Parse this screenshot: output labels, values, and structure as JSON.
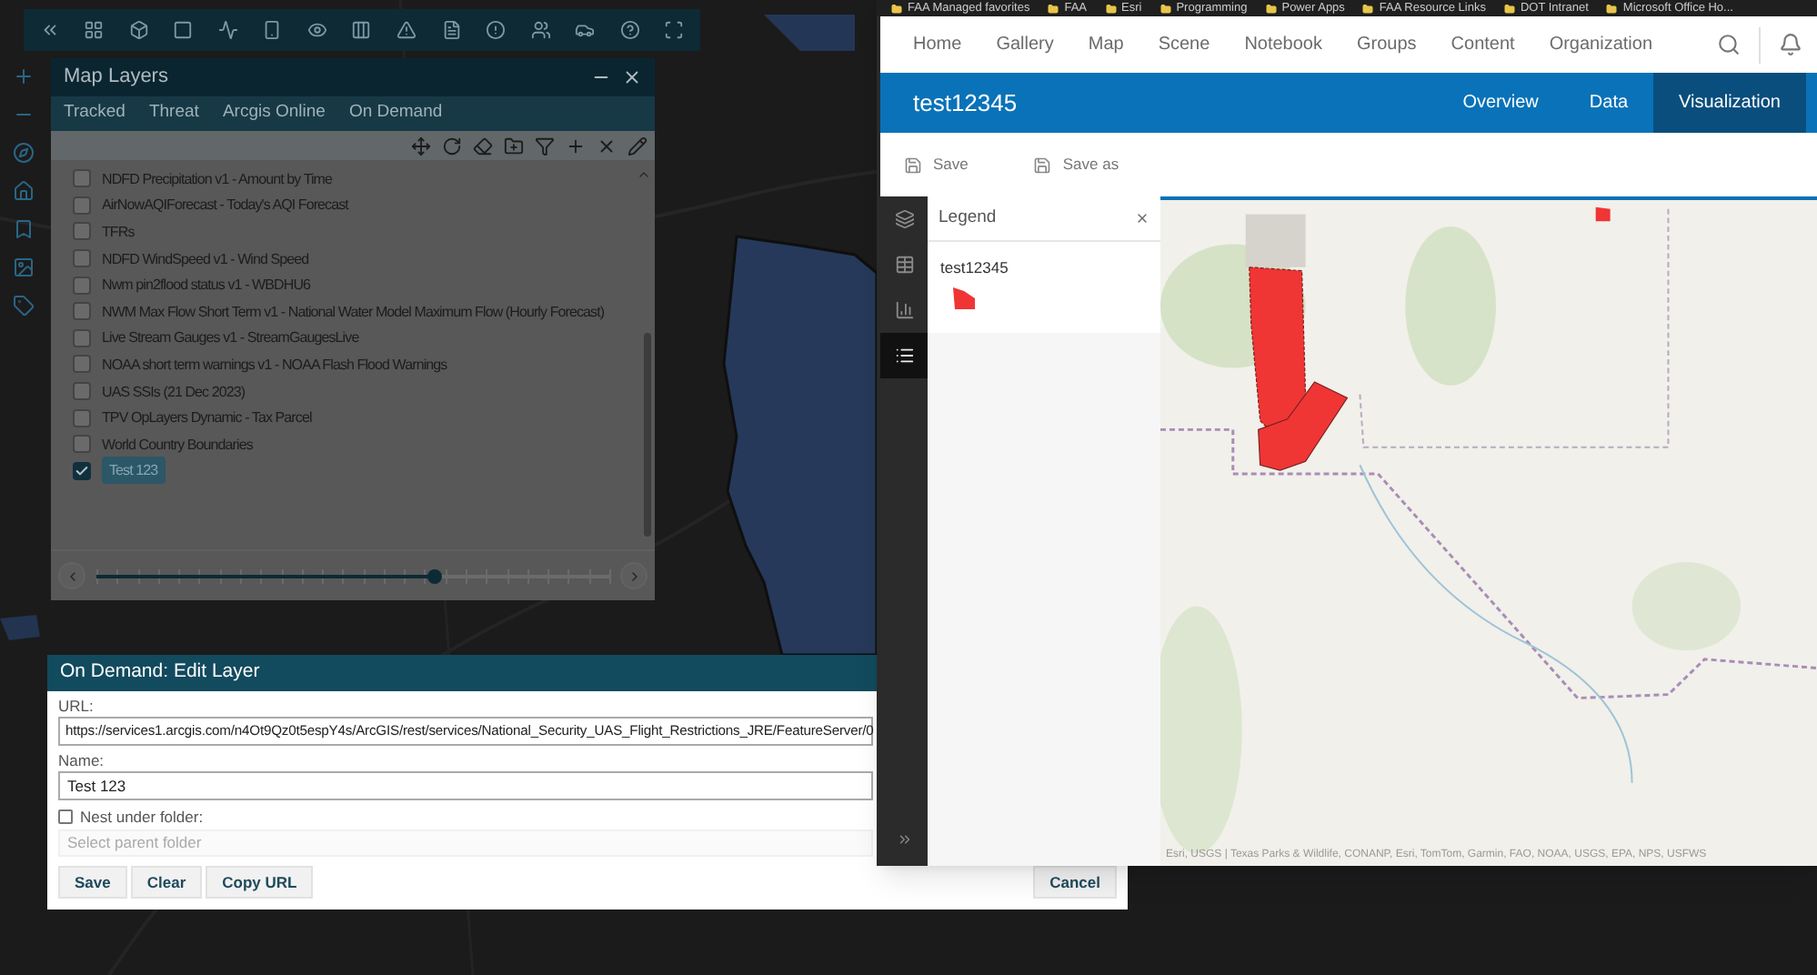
{
  "map_layers": {
    "title": "Map Layers",
    "tabs": [
      {
        "label": "Tracked",
        "selected": false
      },
      {
        "label": "Threat",
        "selected": false
      },
      {
        "label": "Arcgis Online",
        "selected": false
      },
      {
        "label": "On Demand",
        "selected": false
      }
    ],
    "layers": [
      {
        "label": "NDFD Precipitation v1 - Amount by Time",
        "checked": false,
        "selected": false
      },
      {
        "label": "AirNowAQIForecast - Today's AQI Forecast",
        "checked": false,
        "selected": false
      },
      {
        "label": "TFRs",
        "checked": false,
        "selected": false
      },
      {
        "label": "NDFD WindSpeed v1 - Wind Speed",
        "checked": false,
        "selected": false
      },
      {
        "label": "Nwm pin2flood status v1 - WBDHU6",
        "checked": false,
        "selected": false
      },
      {
        "label": "NWM Max Flow Short Term v1 - National Water Model Maximum Flow (Hourly Forecast)",
        "checked": false,
        "selected": false
      },
      {
        "label": "Live Stream Gauges v1 - StreamGaugesLive",
        "checked": false,
        "selected": false
      },
      {
        "label": "NOAA short term warnings v1 - NOAA Flash Flood Warnings",
        "checked": false,
        "selected": false
      },
      {
        "label": "UAS SSIs (21 Dec 2023)",
        "checked": false,
        "selected": false
      },
      {
        "label": "TPV OpLayers Dynamic - Tax Parcel",
        "checked": false,
        "selected": false
      },
      {
        "label": "World Country Boundaries",
        "checked": false,
        "selected": false
      },
      {
        "label": "Test 123",
        "checked": true,
        "selected": true
      }
    ],
    "time_slider": {
      "level": 0.66
    }
  },
  "edit_layer": {
    "title": "On Demand: Edit Layer",
    "url_label": "URL:",
    "url": "https://services1.arcgis.com/n4Ot9Qz0t5espY4s/ArcGIS/rest/services/National_Security_UAS_Flight_Restrictions_JRE/FeatureServer/0",
    "name_label": "Name:",
    "name": "Test 123",
    "nest": {
      "label": "Nest under folder:",
      "checked": false
    },
    "folder_placeholder": "Select parent folder",
    "buttons": [
      "Save",
      "Clear",
      "Copy URL"
    ],
    "cancel": "Cancel"
  },
  "browser": {
    "bookmarks": [
      "FAA Managed favorites",
      "FAA",
      "Esri",
      "Programming",
      "Power Apps",
      "FAA Resource Links",
      "DOT Intranet",
      "Microsoft Office Ho..."
    ],
    "nav": [
      "Home",
      "Gallery",
      "Map",
      "Scene",
      "Notebook",
      "Groups",
      "Content",
      "Organization"
    ],
    "item_title": "test12345",
    "tabs": [
      {
        "label": "Overview",
        "selected": false
      },
      {
        "label": "Data",
        "selected": false
      },
      {
        "label": "Visualization",
        "selected": true
      }
    ],
    "actions": [
      "Save",
      "Save as"
    ],
    "side_tools": [
      {
        "kind": "layers",
        "selected": false
      },
      {
        "kind": "table",
        "selected": false
      },
      {
        "kind": "chart",
        "selected": false
      },
      {
        "kind": "legend",
        "selected": true
      }
    ],
    "legend": {
      "title": "Legend",
      "layer": "test12345"
    },
    "attribution": "Esri, USGS | Texas Parks & Wildlife, CONANP, Esri, TomTom, Garmin, FAO, NOAA, USGS, EPA, NPS, USFWS"
  }
}
